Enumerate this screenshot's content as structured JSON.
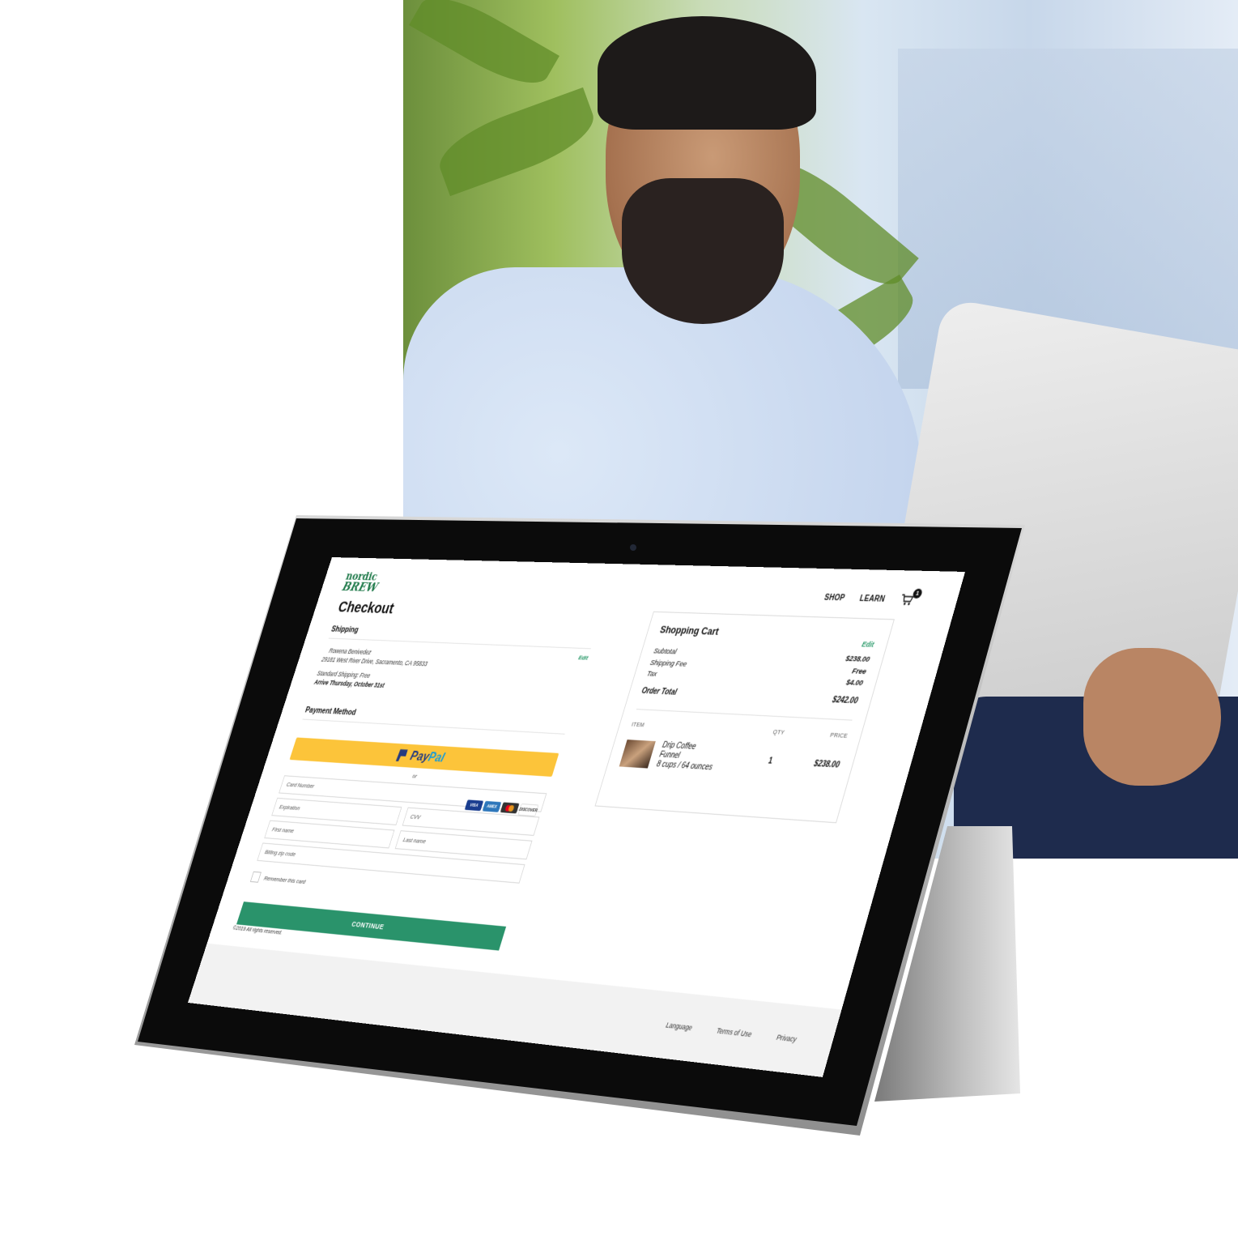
{
  "brand": {
    "name_line1": "nordic",
    "name_line2": "BREW",
    "color": "#1f7a4a"
  },
  "nav": {
    "items": [
      "SHOP",
      "LEARN"
    ],
    "cart_count": "1"
  },
  "checkout": {
    "title": "Checkout",
    "shipping": {
      "title": "Shipping",
      "edit_label": "Edit",
      "name": "Rowena Benivedez",
      "address": "29181 West River Drive, Sacramento, CA 95833",
      "method": "Standard Shipping: Free",
      "arrival": "Arrive Thursday, October 31st"
    },
    "payment": {
      "title": "Payment Method",
      "paypal_part1": "Pay",
      "paypal_part2": "Pal",
      "or_label": "or",
      "fields": {
        "card_number": "Card Number",
        "expiration": "Expiration",
        "cvv": "CVV",
        "first_name": "First name",
        "last_name": "Last name",
        "zip": "Billing zip code"
      },
      "card_logos": [
        {
          "name": "VISA",
          "color": "#1a3d8f"
        },
        {
          "name": "AMEX",
          "color": "#2e77bb"
        },
        {
          "name": "MC",
          "color": "#333333"
        },
        {
          "name": "DISCOVER",
          "color": "#ffffff"
        }
      ],
      "remember_label": "Remember this card",
      "continue_label": "CONTINUE"
    }
  },
  "cart": {
    "title": "Shopping Cart",
    "edit_label": "Edit",
    "subtotal_label": "Subtotal",
    "subtotal_value": "$238.00",
    "shipping_label": "Shipping Fee",
    "shipping_value": "Free",
    "tax_label": "Tax",
    "tax_value": "$4.00",
    "total_label": "Order Total",
    "total_value": "$242.00",
    "columns": {
      "item": "ITEM",
      "qty": "QTY",
      "price": "PRICE"
    },
    "items": [
      {
        "name_line1": "Drip Coffee",
        "name_line2": "Funnel",
        "name_line3": "8 cups / 64 ounces",
        "qty": "1",
        "price": "$238.00"
      }
    ]
  },
  "footer": {
    "copyright": "©2019 All rights reserved.",
    "links": [
      "Language",
      "Terms of Use",
      "Privacy"
    ]
  },
  "colors": {
    "accent": "#2a936b",
    "paypal_yellow": "#fcc43a",
    "paypal_blue": "#253b80"
  }
}
